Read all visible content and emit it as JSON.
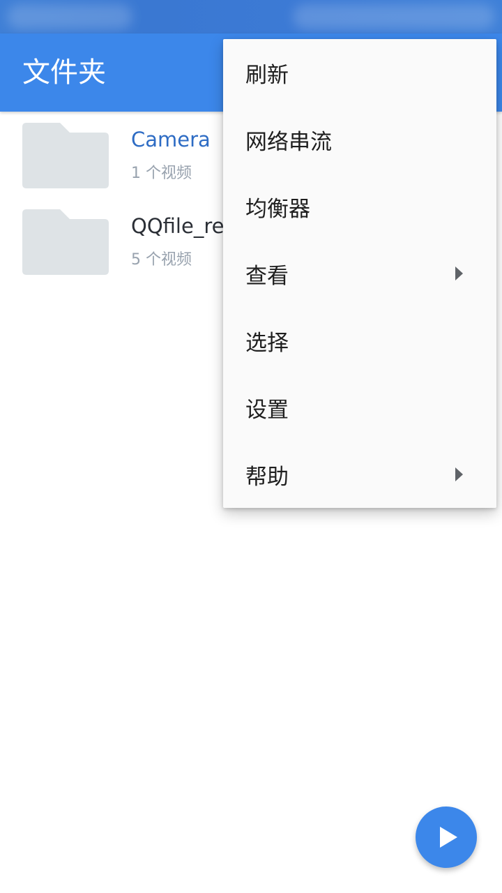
{
  "app_bar": {
    "title": "文件夹"
  },
  "folders": [
    {
      "name": "Camera",
      "count": "1 个视频",
      "icon": "folder-icon"
    },
    {
      "name": "QQfile_recv",
      "count": "5 个视频",
      "icon": "folder-icon"
    }
  ],
  "overflow_menu": {
    "items": [
      {
        "label": "刷新"
      },
      {
        "label": "网络串流"
      },
      {
        "label": "均衡器"
      },
      {
        "label": "查看",
        "has_submenu": true
      },
      {
        "label": "选择"
      },
      {
        "label": "设置"
      },
      {
        "label": "帮助",
        "has_submenu": true
      }
    ]
  },
  "fab": {
    "icon": "play-icon"
  },
  "colors": {
    "primary": "#3c87ea",
    "folder_name_accent": "#2e6cc4",
    "folder_icon": "#dee3e6",
    "secondary_text": "#98a2ae",
    "menu_background": "#fafafa"
  }
}
